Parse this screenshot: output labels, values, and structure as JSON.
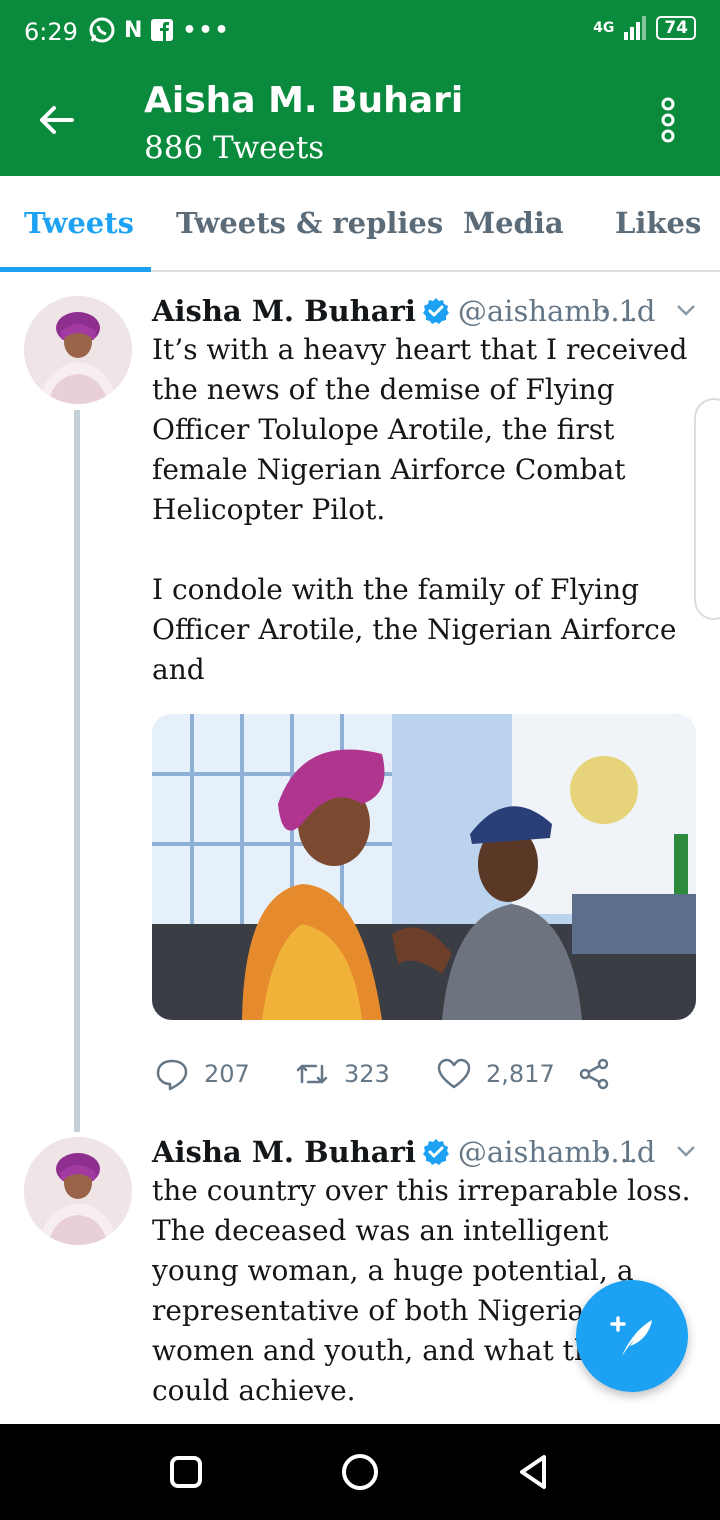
{
  "status_bar": {
    "time": "6:29",
    "network": "4G",
    "battery": "74",
    "overflow": "•••"
  },
  "header": {
    "title": "Aisha M. Buhari",
    "subtitle": "886 Tweets",
    "back_icon": "arrow-left-icon",
    "more_icon": "more-vertical-icon"
  },
  "tabs": [
    {
      "label": "Tweets",
      "active": true
    },
    {
      "label": "Tweets & replies",
      "active": false
    },
    {
      "label": "Media",
      "active": false
    },
    {
      "label": "Likes",
      "active": false
    }
  ],
  "tweets": [
    {
      "name": "Aisha M. Buhari",
      "handle": "@aishamb...",
      "time": "· 1d",
      "text": "It’s with a heavy heart that I received the news of the demise of Flying Officer Tolulope Arotile, the first female Nigerian Airforce Combat Helicopter Pilot.\n\nI condole with the family of Flying Officer Arotile, the Nigerian Airforce and",
      "replies": "207",
      "retweets": "323",
      "likes": "2,817"
    },
    {
      "name": "Aisha M. Buhari",
      "handle": "@aishamb...",
      "time": "· 1d",
      "text": "the country over this irreparable loss. The deceased was an intelligent young woman, a huge potential, a representative of both Nigerian women and youth, and what they could achieve."
    }
  ],
  "colors": {
    "header_green": "#0a8a3c",
    "accent_blue": "#1da1f2",
    "muted": "#657786"
  }
}
